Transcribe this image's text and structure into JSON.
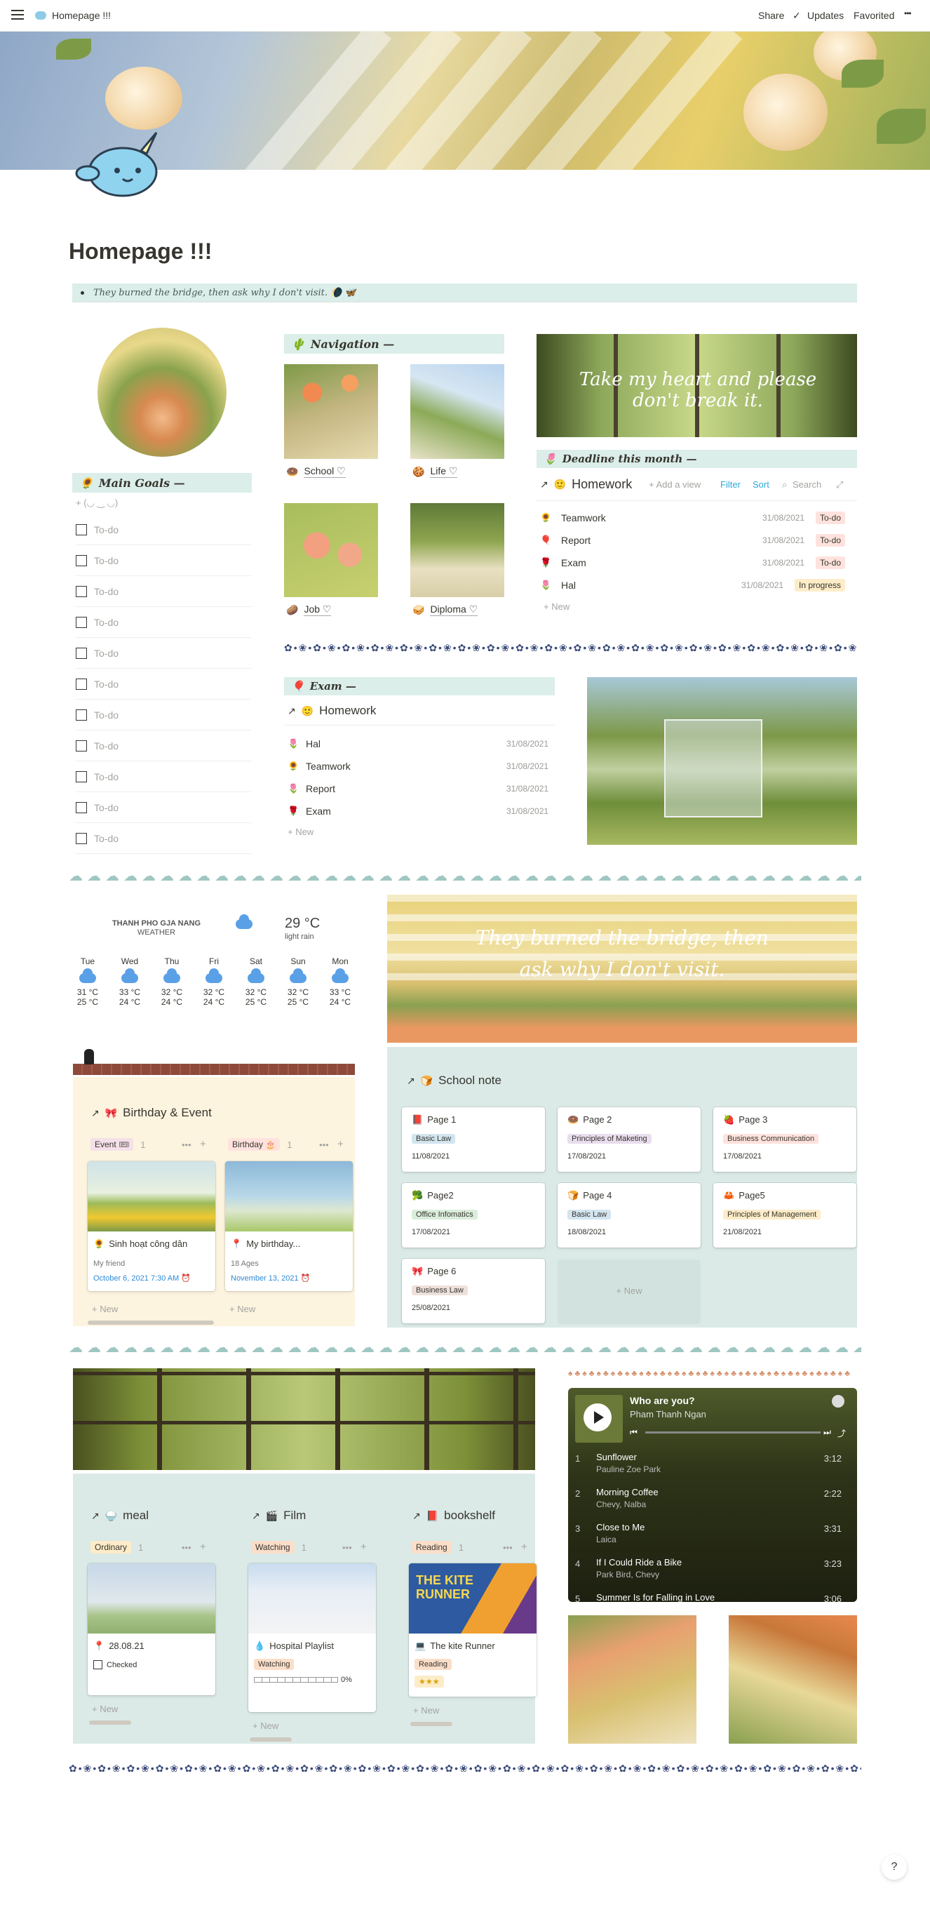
{
  "topbar": {
    "crumb_icon": "narwhal-icon",
    "title": "Homepage !!!",
    "share": "Share",
    "updates": "Updates",
    "favorited": "Favorited",
    "more": "•••"
  },
  "page": {
    "title": "Homepage !!!",
    "quote": "They burned the bridge, then ask why I don't visit. 🌘 🦋"
  },
  "main_goals": {
    "header": "Main Goals —",
    "add_label": "+ (◡ ‿ ◡)",
    "todos": [
      "To-do",
      "To-do",
      "To-do",
      "To-do",
      "To-do",
      "To-do",
      "To-do",
      "To-do",
      "To-do",
      "To-do",
      "To-do"
    ]
  },
  "navigation": {
    "header": "Navigation —",
    "items": [
      {
        "icon": "🍩",
        "label": "School ♡"
      },
      {
        "icon": "🍪",
        "label": "Life ♡"
      },
      {
        "icon": "🥔",
        "label": "Job ♡"
      },
      {
        "icon": "🥪",
        "label": "Diploma ♡"
      }
    ]
  },
  "banner1": {
    "text": "Take my heart and please don't break it."
  },
  "deadline": {
    "header": "Deadline this month —",
    "db_title": "Homework",
    "add_view": "+ Add a view",
    "filter": "Filter",
    "sort": "Sort",
    "search": "Search",
    "rows": [
      {
        "name": "Teamwork",
        "date": "31/08/2021",
        "status": "To-do"
      },
      {
        "name": "Report",
        "date": "31/08/2021",
        "status": "To-do"
      },
      {
        "name": "Exam",
        "date": "31/08/2021",
        "status": "To-do"
      },
      {
        "name": "Hal",
        "date": "31/08/2021",
        "status": "In progress"
      }
    ],
    "new": "+ New"
  },
  "exam": {
    "header": "Exam —",
    "db_title": "Homework",
    "rows": [
      {
        "name": "Hal",
        "date": "31/08/2021"
      },
      {
        "name": "Teamwork",
        "date": "31/08/2021"
      },
      {
        "name": "Report",
        "date": "31/08/2021"
      },
      {
        "name": "Exam",
        "date": "31/08/2021"
      }
    ],
    "new": "+ New"
  },
  "weather": {
    "city": "THANH PHO GJA NANG",
    "label": "WEATHER",
    "temp": "29 °C",
    "desc": "light rain",
    "days": [
      {
        "d": "Tue",
        "hi": "31 °C",
        "lo": "25 °C"
      },
      {
        "d": "Wed",
        "hi": "33 °C",
        "lo": "24 °C"
      },
      {
        "d": "Thu",
        "hi": "32 °C",
        "lo": "24 °C"
      },
      {
        "d": "Fri",
        "hi": "32 °C",
        "lo": "24 °C"
      },
      {
        "d": "Sat",
        "hi": "32 °C",
        "lo": "25 °C"
      },
      {
        "d": "Sun",
        "hi": "32 °C",
        "lo": "25 °C"
      },
      {
        "d": "Mon",
        "hi": "33 °C",
        "lo": "24 °C"
      }
    ]
  },
  "banner2": {
    "line1": "They burned the bridge, then",
    "line2": "ask why I don't visit."
  },
  "birthday": {
    "title": "Birthday & Event",
    "groups": [
      {
        "tag": "Event 🎟",
        "count": "1",
        "card_title": "Sinh hoạt công dân",
        "sub": "My friend",
        "date": "October 6, 2021 7:30 AM ⏰"
      },
      {
        "tag": "Birthday 🎂",
        "count": "1",
        "card_title": "My birthday...",
        "sub": "18 Ages",
        "date": "November 13, 2021 ⏰"
      }
    ],
    "new": "+ New"
  },
  "school_note": {
    "title": "School note",
    "cards": [
      {
        "title": "Page 1",
        "tag": "Basic Law",
        "date": "11/08/2021",
        "color": "#d3e5ef"
      },
      {
        "title": "Page 2",
        "tag": "Principles of Maketing",
        "date": "17/08/2021",
        "color": "#e8deee"
      },
      {
        "title": "Page 3",
        "tag": "Business Communication",
        "date": "17/08/2021",
        "color": "#ffe2dd"
      },
      {
        "title": "Page2",
        "tag": "Office Infomatics",
        "date": "17/08/2021",
        "color": "#dbeddb"
      },
      {
        "title": "Page 4",
        "tag": "Basic Law",
        "date": "18/08/2021",
        "color": "#d3e5ef"
      },
      {
        "title": "Page5",
        "tag": "Principles of Management",
        "date": "21/08/2021",
        "color": "#fdecc8"
      },
      {
        "title": "Page 6",
        "tag": "Business Law",
        "date": "25/08/2021",
        "color": "#eee0da"
      }
    ],
    "new": "+ New"
  },
  "boards": [
    {
      "title": "meal",
      "group": "Ordinary",
      "count": "1",
      "card": "28.08.21",
      "prop": "Checked",
      "new": "+ New"
    },
    {
      "title": "Film",
      "group": "Watching",
      "count": "1",
      "card": "Hospital Playlist",
      "prop": "Watching",
      "progress": "0%",
      "new": "+ New"
    },
    {
      "title": "bookshelf",
      "group": "Reading",
      "count": "1",
      "card": "The kite Runner",
      "prop": "Reading",
      "stars": "★★★",
      "new": "+ New",
      "cover_text": "THE KITE RUNNER"
    }
  ],
  "player": {
    "title": "Who are you?",
    "artist": "Pham Thanh Ngan",
    "tracks": [
      {
        "n": "1",
        "t": "Sunflower",
        "a": "Pauline Zoe Park",
        "d": "3:12"
      },
      {
        "n": "2",
        "t": "Morning Coffee",
        "a": "Chevy, Nalba",
        "d": "2:22"
      },
      {
        "n": "3",
        "t": "Close to Me",
        "a": "Laica",
        "d": "3:31"
      },
      {
        "n": "4",
        "t": "If I Could Ride a Bike",
        "a": "Park Bird, Chevy",
        "d": "3:23"
      },
      {
        "n": "5",
        "t": "Summer Is for Falling in Love",
        "a": "",
        "d": "3:06"
      }
    ]
  },
  "help": "?"
}
